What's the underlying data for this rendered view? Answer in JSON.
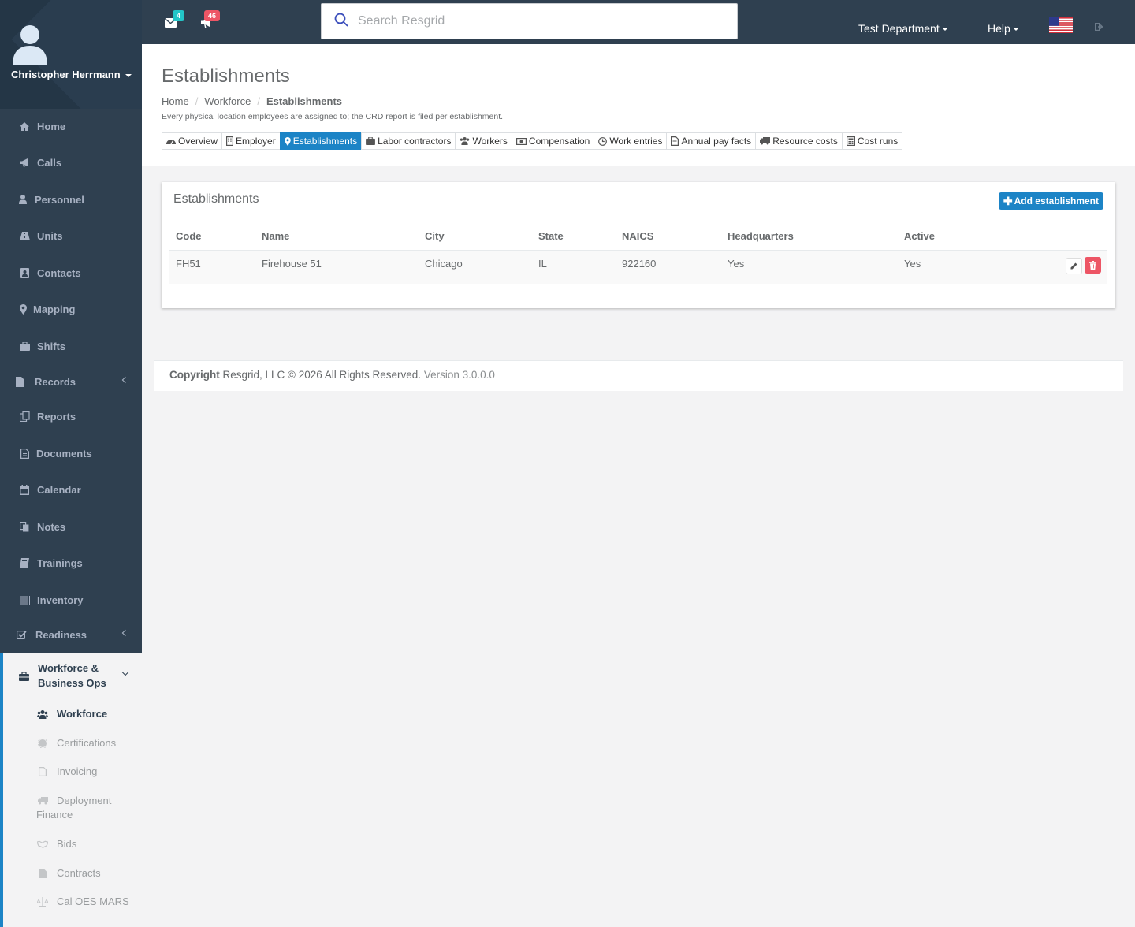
{
  "user": {
    "name": "Christopher Herrmann"
  },
  "topbar": {
    "mail_count": "4",
    "alerts_count": "46",
    "search_placeholder": "Search Resgrid",
    "department": "Test Department",
    "help": "Help"
  },
  "nav": {
    "home": "Home",
    "calls": "Calls",
    "personnel": "Personnel",
    "units": "Units",
    "contacts": "Contacts",
    "mapping": "Mapping",
    "shifts": "Shifts",
    "records": "Records",
    "reports": "Reports",
    "documents": "Documents",
    "calendar": "Calendar",
    "notes": "Notes",
    "trainings": "Trainings",
    "inventory": "Inventory",
    "readiness": "Readiness",
    "workforce_section_line1": "Workforce &",
    "workforce_section_line2": "Business Ops",
    "sub": {
      "workforce": "Workforce",
      "certifications": "Certifications",
      "invoicing": "Invoicing",
      "deployment_line1": "Deployment",
      "deployment_line2": "Finance",
      "bids": "Bids",
      "contracts": "Contracts",
      "calmars": "Cal OES MARS"
    }
  },
  "page": {
    "title": "Establishments",
    "breadcrumb": {
      "home": "Home",
      "workforce": "Workforce",
      "current": "Establishments"
    },
    "subtitle": "Every physical location employees are assigned to; the CRD report is filed per establishment.",
    "tabs": {
      "overview": "Overview",
      "employer": "Employer",
      "establishments": "Establishments",
      "labor": "Labor contractors",
      "workers": "Workers",
      "compensation": "Compensation",
      "work_entries": "Work entries",
      "annual_pay": "Annual pay facts",
      "resource_costs": "Resource costs",
      "cost_runs": "Cost runs"
    }
  },
  "panel": {
    "title": "Establishments",
    "add_label": "Add establishment",
    "columns": {
      "code": "Code",
      "name": "Name",
      "city": "City",
      "state": "State",
      "naics": "NAICS",
      "hq": "Headquarters",
      "active": "Active"
    },
    "rows": [
      {
        "code": "FH51",
        "name": "Firehouse 51",
        "city": "Chicago",
        "state": "IL",
        "naics": "922160",
        "hq": "Yes",
        "active": "Yes"
      }
    ]
  },
  "footer": {
    "copyright_label": "Copyright",
    "copyright_text": " Resgrid, LLC © 2026 All Rights Reserved. ",
    "version": "Version 3.0.0.0"
  },
  "colors": {
    "sidebar": "#2f4050",
    "accent": "#1c84c6",
    "danger": "#ed5565",
    "badge_teal": "#23c6c8"
  },
  "icons": {
    "flag": "us-flag-icon",
    "logout": "sign-out-icon"
  }
}
